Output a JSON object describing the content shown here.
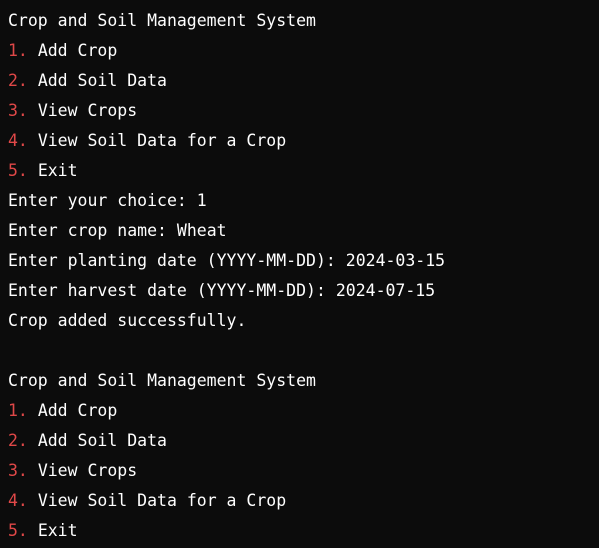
{
  "colors": {
    "background": "#0c0c0c",
    "text": "#ffffff",
    "menu_number": "#e04848"
  },
  "block1": {
    "title": "Crop and Soil Management System",
    "menu": [
      {
        "num": "1.",
        "label": "Add Crop"
      },
      {
        "num": "2.",
        "label": "Add Soil Data"
      },
      {
        "num": "3.",
        "label": "View Crops"
      },
      {
        "num": "4.",
        "label": "View Soil Data for a Crop"
      },
      {
        "num": "5.",
        "label": "Exit"
      }
    ],
    "prompts": [
      {
        "prompt": "Enter your choice: ",
        "value": "1"
      },
      {
        "prompt": "Enter crop name: ",
        "value": "Wheat"
      },
      {
        "prompt": "Enter planting date (YYYY-MM-DD): ",
        "value": "2024-03-15"
      },
      {
        "prompt": "Enter harvest date (YYYY-MM-DD): ",
        "value": "2024-07-15"
      }
    ],
    "result": "Crop added successfully."
  },
  "block2": {
    "title": "Crop and Soil Management System",
    "menu": [
      {
        "num": "1.",
        "label": "Add Crop"
      },
      {
        "num": "2.",
        "label": "Add Soil Data"
      },
      {
        "num": "3.",
        "label": "View Crops"
      },
      {
        "num": "4.",
        "label": "View Soil Data for a Crop"
      },
      {
        "num": "5.",
        "label": "Exit"
      }
    ]
  }
}
